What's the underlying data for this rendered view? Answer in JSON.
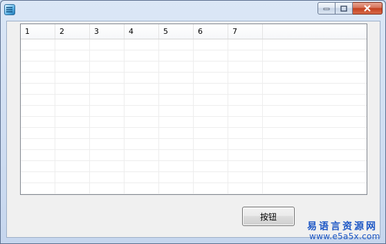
{
  "window": {
    "title": "",
    "icon": "app-logo-icon",
    "controls": {
      "minimize_icon": "minimize-icon",
      "maximize_icon": "maximize-icon",
      "close_icon": "close-icon"
    }
  },
  "table": {
    "columns": [
      "1",
      "2",
      "3",
      "4",
      "5",
      "6",
      "7"
    ],
    "row_count": 14
  },
  "button": {
    "label": "按钮"
  },
  "watermark": {
    "name": "易语言资源网",
    "url": "www.e5a5x.com"
  },
  "colors": {
    "close_button": "#c3401f",
    "watermark": "#1f58c5",
    "title_bar": "#c6d6ee"
  }
}
